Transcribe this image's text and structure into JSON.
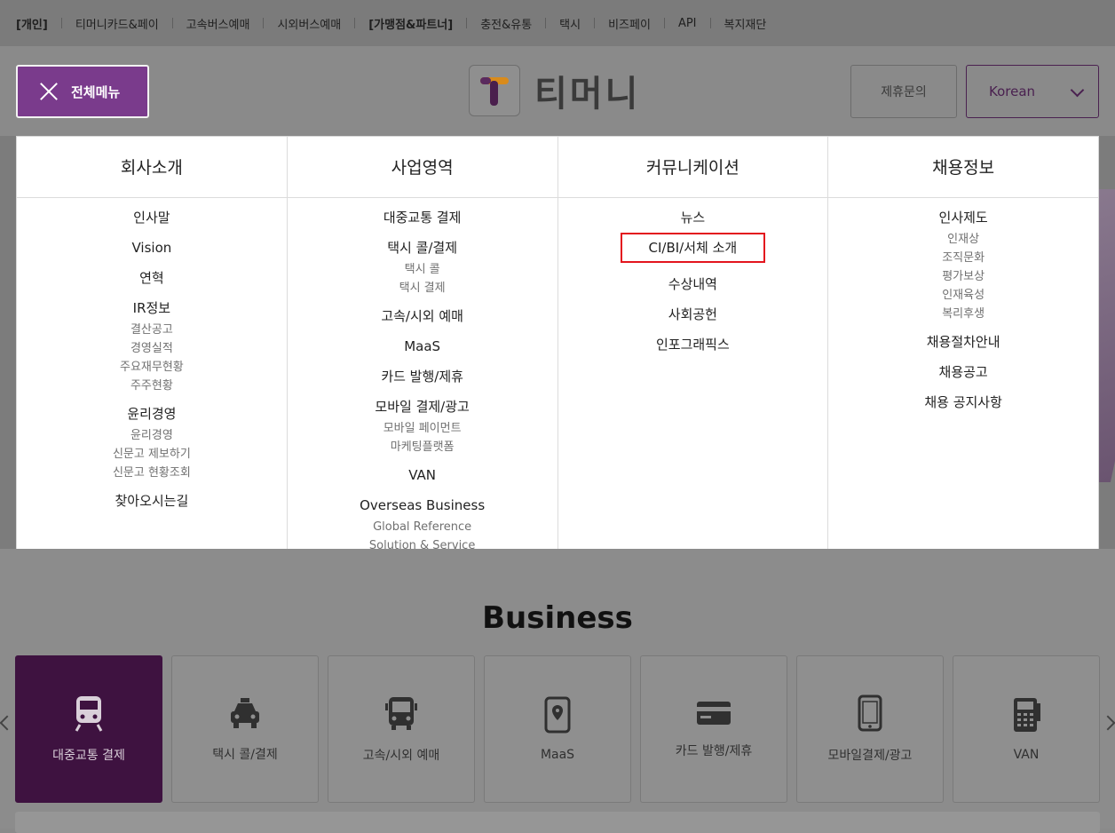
{
  "topbar": {
    "links": [
      {
        "label": "[개인]",
        "bold": true
      },
      {
        "label": "티머니카드&페이",
        "bold": false
      },
      {
        "label": "고속버스예매",
        "bold": false
      },
      {
        "label": "시외버스예매",
        "bold": false
      },
      {
        "label": "[가맹점&파트너]",
        "bold": true
      },
      {
        "label": "충전&유통",
        "bold": false
      },
      {
        "label": "택시",
        "bold": false
      },
      {
        "label": "비즈페이",
        "bold": false
      },
      {
        "label": "API",
        "bold": false
      },
      {
        "label": "복지재단",
        "bold": false
      }
    ]
  },
  "header": {
    "menu_label": "전체메뉴",
    "logo_text": "티머니",
    "partner_label": "제휴문의",
    "language": "Korean"
  },
  "mega_menu": {
    "columns": [
      {
        "title": "회사소개",
        "items": [
          {
            "label": "인사말",
            "sub": []
          },
          {
            "label": "Vision",
            "sub": []
          },
          {
            "label": "연혁",
            "sub": []
          },
          {
            "label": "IR정보",
            "sub": [
              "결산공고",
              "경영실적",
              "주요재무현황",
              "주주현황"
            ]
          },
          {
            "label": "윤리경영",
            "sub": [
              "윤리경영",
              "신문고 제보하기",
              "신문고 현황조회"
            ]
          },
          {
            "label": "찾아오시는길",
            "sub": []
          }
        ]
      },
      {
        "title": "사업영역",
        "items": [
          {
            "label": "대중교통 결제",
            "sub": []
          },
          {
            "label": "택시 콜/결제",
            "sub": [
              "택시 콜",
              "택시 결제"
            ]
          },
          {
            "label": "고속/시외 예매",
            "sub": []
          },
          {
            "label": "MaaS",
            "sub": []
          },
          {
            "label": "카드 발행/제휴",
            "sub": []
          },
          {
            "label": "모바일 결제/광고",
            "sub": [
              "모바일 페이먼트",
              "마케팅플랫폼"
            ]
          },
          {
            "label": "VAN",
            "sub": []
          },
          {
            "label": "Overseas Business",
            "sub": [
              "Global Reference",
              "Solution & Service"
            ]
          }
        ]
      },
      {
        "title": "커뮤니케이션",
        "items": [
          {
            "label": "뉴스",
            "sub": []
          },
          {
            "label": "CI/BI/서체 소개",
            "sub": [],
            "highlighted": true
          },
          {
            "label": "수상내역",
            "sub": []
          },
          {
            "label": "사회공헌",
            "sub": []
          },
          {
            "label": "인포그래픽스",
            "sub": []
          }
        ]
      },
      {
        "title": "채용정보",
        "items": [
          {
            "label": "인사제도",
            "sub": [
              "인재상",
              "조직문화",
              "평가보상",
              "인재육성",
              "복리후생"
            ]
          },
          {
            "label": "채용절차안내",
            "sub": []
          },
          {
            "label": "채용공고",
            "sub": []
          },
          {
            "label": "채용 공지사항",
            "sub": []
          }
        ]
      }
    ]
  },
  "business": {
    "title": "Business",
    "cards": [
      {
        "label": "대중교통 결제",
        "icon": "train-icon",
        "active": true
      },
      {
        "label": "택시 콜/결제",
        "icon": "taxi-icon",
        "active": false
      },
      {
        "label": "고속/시외 예매",
        "icon": "bus-icon",
        "active": false
      },
      {
        "label": "MaaS",
        "icon": "phone-map-icon",
        "active": false
      },
      {
        "label": "카드 발행/제휴",
        "icon": "card-icon",
        "active": false
      },
      {
        "label": "모바일결제/광고",
        "icon": "mobile-icon",
        "active": false
      },
      {
        "label": "VAN",
        "icon": "terminal-icon",
        "active": false
      }
    ]
  },
  "colors": {
    "brand_purple": "#7a3b8c",
    "highlight_red": "#e3151e"
  }
}
